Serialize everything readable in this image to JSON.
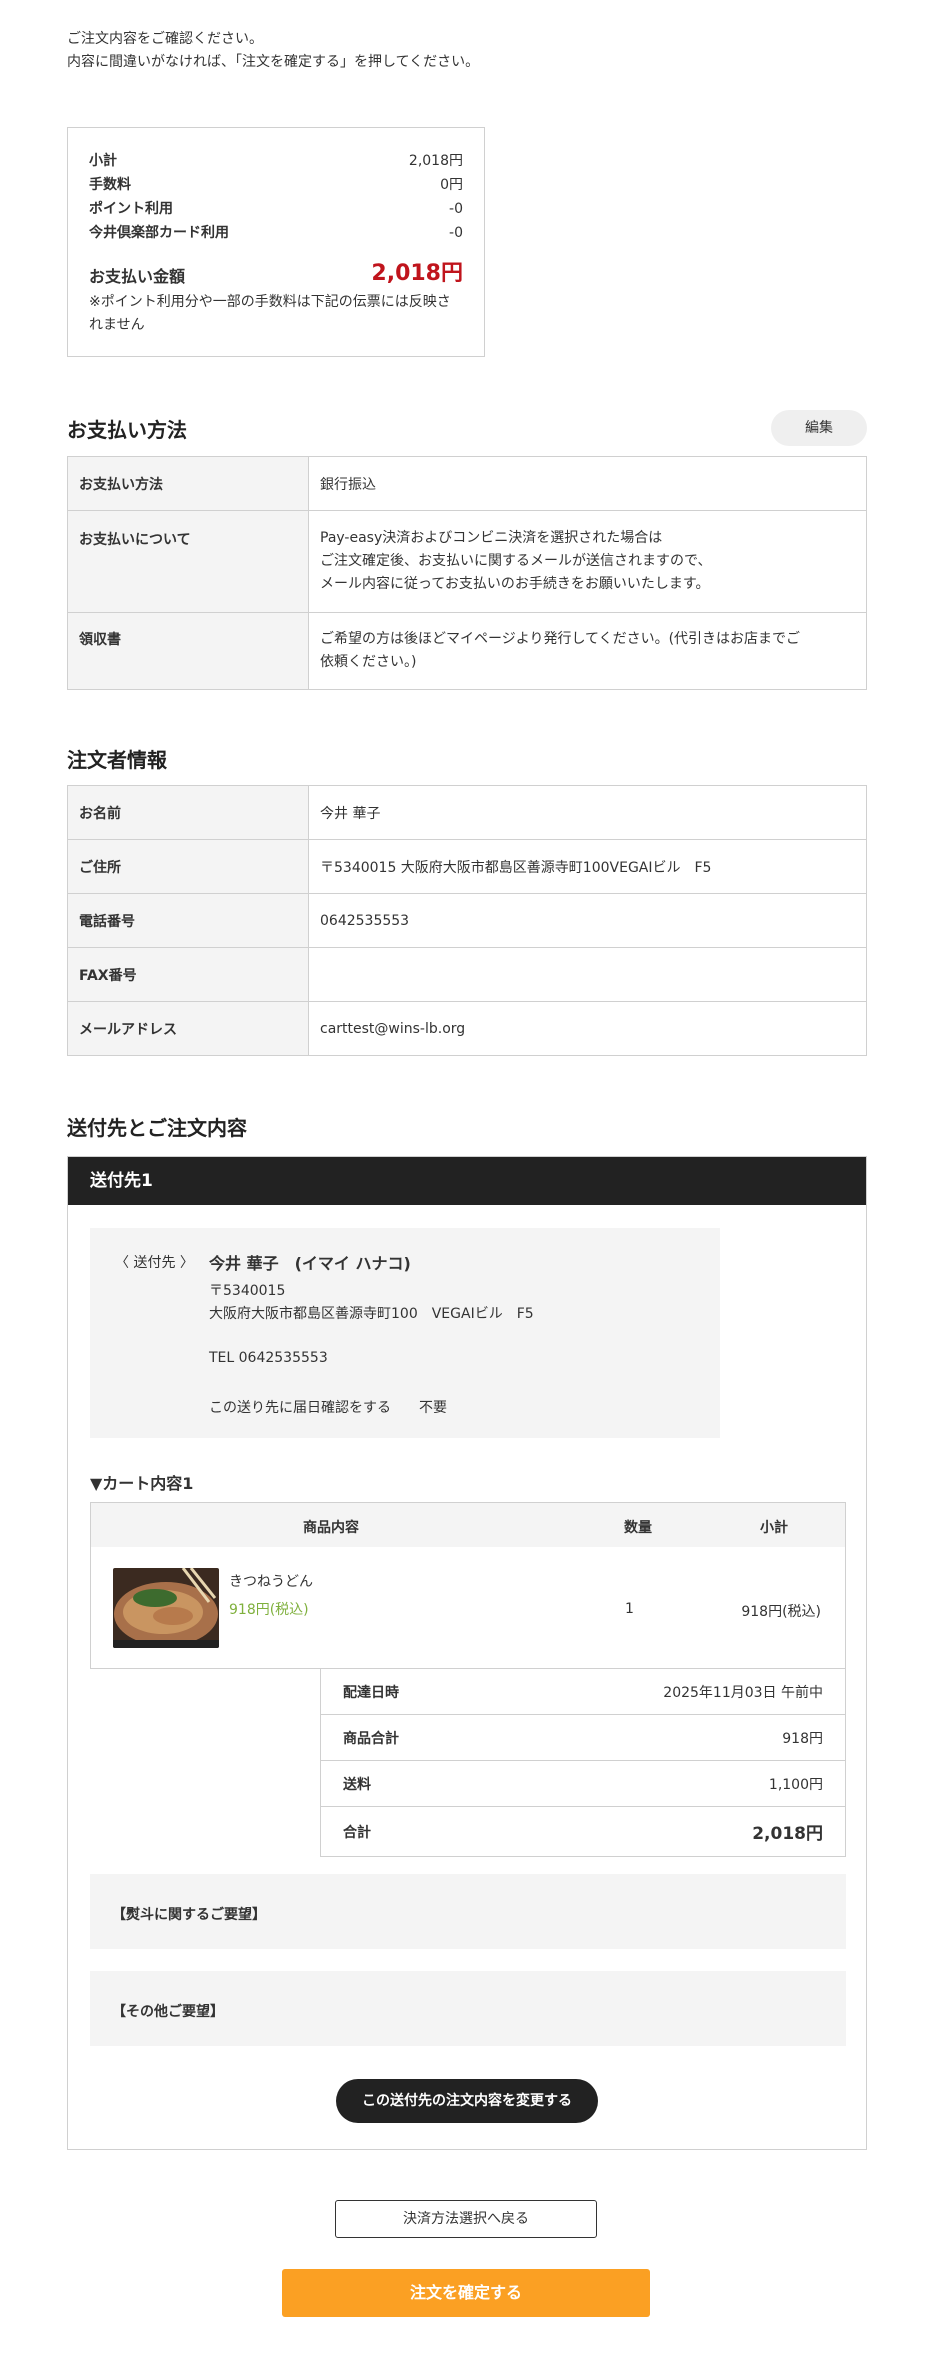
{
  "intro": {
    "line1": "ご注文内容をご確認ください。",
    "line2": "内容に間違いがなければ、「注文を確定する」を押してください。"
  },
  "summary": {
    "rows": [
      {
        "label": "小計",
        "value": "2,018円"
      },
      {
        "label": "手数料",
        "value": "0円"
      },
      {
        "label": "ポイント利用",
        "value": "-0"
      },
      {
        "label": "今井倶楽部カード利用",
        "value": "-0"
      }
    ],
    "total_label": "お支払い金額",
    "total_value": "2,018円",
    "note": "※ポイント利用分や一部の手数料は下記の伝票には反映されません"
  },
  "payment": {
    "title": "お支払い方法",
    "edit_label": "編集",
    "rows": [
      {
        "label": "お支払い方法",
        "value": "銀行振込"
      },
      {
        "label": "お支払いについて",
        "lines": [
          "Pay-easy決済およびコンビニ決済を選択された場合は",
          "ご注文確定後、お支払いに関するメールが送信されますので、",
          "メール内容に従ってお支払いのお手続きをお願いいたします。"
        ]
      },
      {
        "label": "領収書",
        "lines": [
          "ご希望の方は後ほどマイページより発行してください。(代引きはお店までご",
          "依頼ください。)"
        ]
      }
    ]
  },
  "orderer": {
    "title": "注文者情報",
    "rows": [
      {
        "label": "お名前",
        "value": "今井 華子"
      },
      {
        "label": "ご住所",
        "value": "〒5340015 大阪府大阪市都島区善源寺町100VEGAⅠビル　F5"
      },
      {
        "label": "電話番号",
        "value": "0642535553"
      },
      {
        "label": "FAX番号",
        "value": ""
      },
      {
        "label": "メールアドレス",
        "value": "carttest@wins-lb.org"
      }
    ]
  },
  "shipping": {
    "title": "送付先とご注文内容",
    "header": "送付先1",
    "addr_label": "〈 送付先 〉",
    "name": "今井 華子　(イマイ ハナコ)",
    "zip": "〒5340015",
    "address": "大阪府大阪市都島区善源寺町100　VEGAⅠビル　F5",
    "tel": "TEL 0642535553",
    "confirm_text": "この送り先に届日確認をする　　不要",
    "cart_title": "▼カート内容1",
    "cols": {
      "item": "商品内容",
      "qty": "数量",
      "sub": "小計"
    },
    "item": {
      "name": "きつねうどん",
      "price": "918円(税込)",
      "qty": "1",
      "subtotal": "918円(税込)"
    },
    "totals": [
      {
        "label": "配達日時",
        "value": "2025年11月03日 午前中"
      },
      {
        "label": "商品合計",
        "value": "918円"
      },
      {
        "label": "送料",
        "value": "1,100円"
      },
      {
        "label": "合計",
        "value": "2,018円"
      }
    ],
    "noshi_req": "【熨斗に関するご要望】",
    "other_req": "【その他ご要望】",
    "change_label": "この送付先の注文内容を変更する"
  },
  "actions": {
    "back_label": "決済方法選択へ戻る",
    "confirm_label": "注文を確定する"
  },
  "colors": {
    "accent": "#fba023",
    "total_red": "#c0141c",
    "price_green": "#7fb03d"
  }
}
